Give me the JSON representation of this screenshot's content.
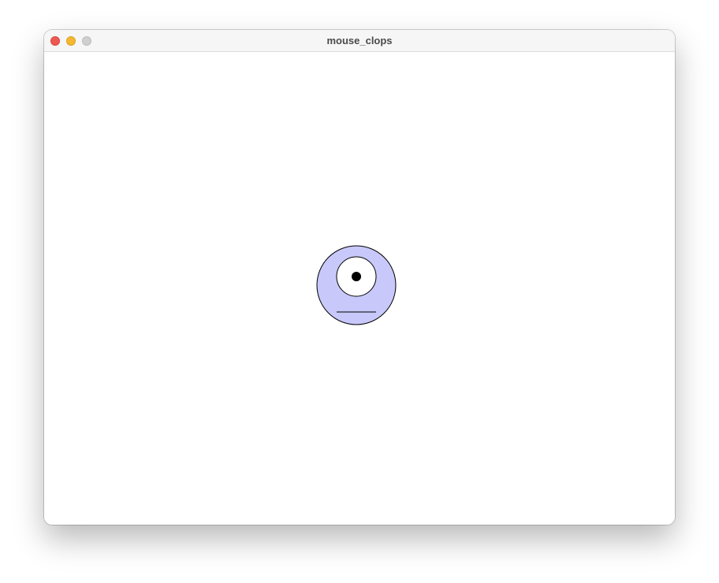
{
  "window": {
    "title": "mouse_clops",
    "controls": {
      "close_color": "#ee5a52",
      "minimize_color": "#f5b82e",
      "zoom_color": "#cfcfcf"
    }
  },
  "sketch": {
    "background_color": "#ffffff",
    "head_fill": "#c8c8fa",
    "eye_fill": "#ffffff",
    "pupil_fill": "#000000",
    "stroke_color": "#000000"
  }
}
